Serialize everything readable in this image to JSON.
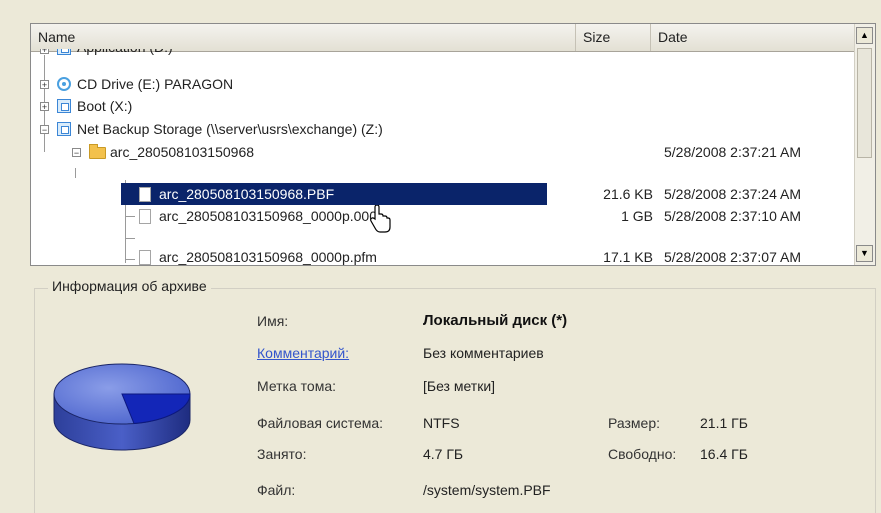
{
  "file_list": {
    "columns": {
      "name": "Name",
      "size": "Size",
      "date": "Date"
    },
    "rows": [
      {
        "label": "Application (D:)",
        "size": "",
        "date": ""
      },
      {
        "label": "CD Drive (E:) PARAGON",
        "size": "",
        "date": ""
      },
      {
        "label": "Boot (X:)",
        "size": "",
        "date": ""
      },
      {
        "label": "Net Backup Storage (\\\\server\\usrs\\exchange) (Z:)",
        "size": "",
        "date": ""
      },
      {
        "label": "arc_280508103150968",
        "size": "",
        "date": "5/28/2008 2:37:21 AM"
      },
      {
        "label": "arc_280508103150968.PBF",
        "size": "21.6 KB",
        "date": "5/28/2008 2:37:24 AM"
      },
      {
        "label": "arc_280508103150968_0000p.000",
        "size": "1 GB",
        "date": "5/28/2008 2:37:10 AM"
      },
      {
        "label": "arc_280508103150968_0000p.pfm",
        "size": "17.1 KB",
        "date": "5/28/2008 2:37:07 AM"
      }
    ],
    "scroll_up_icon": "arrow-up",
    "scroll_down_icon": "arrow-down"
  },
  "archive_info": {
    "group_title": "Информация об архиве",
    "fields": {
      "name_label": "Имя:",
      "name_value": "Локальный диск (*)",
      "comment_label": "Комментарий:",
      "comment_value": "Без комментариев",
      "volume_label_label": "Метка тома:",
      "volume_label_value": "[Без метки]",
      "filesystem_label": "Файловая система:",
      "filesystem_value": "NTFS",
      "size_label": "Размер:",
      "size_value": "21.1 ГБ",
      "used_label": "Занято:",
      "used_value": "4.7 ГБ",
      "free_label": "Свободно:",
      "free_value": "16.4 ГБ",
      "file_label": "Файл:",
      "file_value": "/system/system.PBF"
    },
    "pie_colors": {
      "free": "#4f67c9",
      "used": "#1326b8"
    }
  }
}
